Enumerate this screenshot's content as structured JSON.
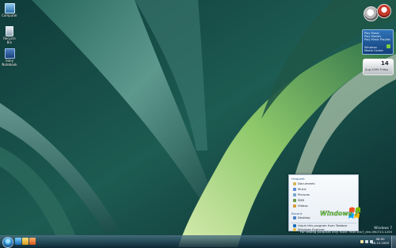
{
  "desktop_icons": [
    {
      "label": "Computer"
    },
    {
      "label": "Recycle Bin"
    },
    {
      "label": "Sony\nNotebook"
    }
  ],
  "media_gadget": {
    "line1": "Play Music",
    "line2": "Play Movies",
    "line3": "Play Music Playlist",
    "line4": "Windows",
    "line5": "Media Center"
  },
  "clock_gadget": {
    "value": "14",
    "subtitle": "Aug 2009 Friday"
  },
  "jumplist": {
    "frequent_header": "Frequent",
    "frequent": [
      "Documents",
      "Music",
      "Pictures",
      "SDB",
      "Videos"
    ],
    "recent_header": "Recent",
    "recent": [
      "Desktop"
    ],
    "tasks": [
      "Unpin this program from Taskbar",
      "Windows Explorer"
    ]
  },
  "branding": {
    "build_line1": "Windows 7",
    "build_line2": "For testing purposes only. Build 7600.win7_rtm.090713-1255",
    "logo_text": "Windows 7 style"
  },
  "taskbar": {
    "time": "08:00",
    "date": "28.10.2009"
  },
  "colors": {
    "taskbar": "#1a3a4c",
    "start_orb": "#2e8fd1",
    "jumplist_bg": "#f3f7fb"
  },
  "icons": [
    "computer-icon",
    "recycle-bin-icon",
    "notebook-icon",
    "start-orb-icon",
    "ie-icon",
    "explorer-icon",
    "media-player-icon"
  ]
}
